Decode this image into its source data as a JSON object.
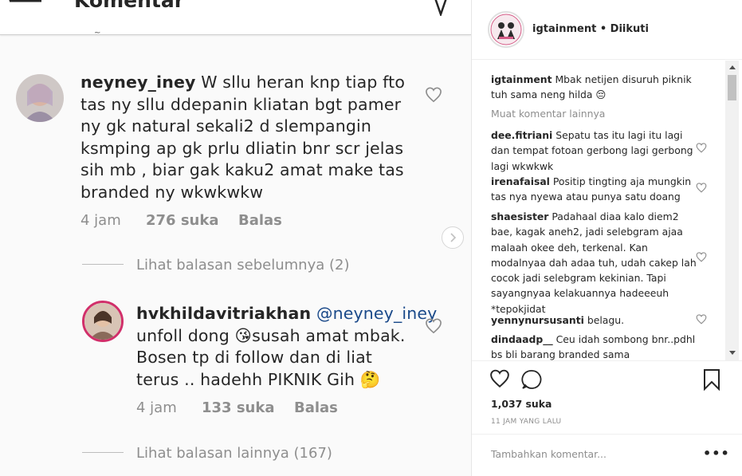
{
  "left": {
    "title": "Komentar",
    "tick_char": "~",
    "comment1": {
      "username": "neyney_iney",
      "lines": [
        "W sllu heran knp tiap fto",
        "tas ny sllu ddepanin kliatan bgt pamer",
        "ny gk natural sekali2 d slempangin",
        "ksmping ap gk prlu dliatin bnr scr jelas",
        "sih mb , biar gak kaku2 amat make tas",
        "branded ny wkwkwkw"
      ],
      "time": "4 jam",
      "likes": "276 suka",
      "reply": "Balas"
    },
    "view_previous": "Lihat balasan sebelumnya (2)",
    "comment2": {
      "username": "hvkhildavitriakhan",
      "mention": "@neyney_iney",
      "line1_a": "unfoll dong",
      "line1_emoji": "😘",
      "line1_b": "susah amat mbak.",
      "line2": "Bosen tp di follow dan di liat",
      "line3": "terus .. hadehh PIKNIK Gih 🤔",
      "time": "4 jam",
      "likes": "133 suka",
      "reply": "Balas"
    },
    "view_more": "Lihat balasan lainnya (167)"
  },
  "right": {
    "poster": "igtainment",
    "follow_status": "• Diikuti",
    "caption_user": "igtainment",
    "caption_text": "Mbak netijen disuruh piknik tuh sama neng hilda 😔",
    "more_comments": "Muat komentar lainnya",
    "comments": [
      {
        "user": "dee.fitriani",
        "text": "Sepatu tas itu lagi itu lagi dan tempat fotoan gerbong lagi gerbong lagi wkwkwk"
      },
      {
        "user": "irenafaisal",
        "text": "Positip tingting aja mungkin tas nya nyewa atau punya satu doang"
      },
      {
        "user": "shaesister",
        "text": "Padahaal diaa kalo diem2 bae, kagak aneh2, jadi selebgram ajaa malaah okee deh, terkenal. Kan modalnyaa dah adaa tuh, udah cakep lah cocok jadi selebgram kekinian. Tapi sayangnyaa kelakuannya hadeeeuh *tepokjidat"
      },
      {
        "user": "yennynursusanti",
        "text": "belagu."
      },
      {
        "user": "dindaadp__",
        "text": "Ceu idah sombong bnr..pdhl bs bli barang branded sama"
      }
    ],
    "likes": "1,037 suka",
    "time_ago": "11 JAM YANG LALU",
    "add_comment_placeholder": "Tambahkan komentar...",
    "more_options": "•••"
  }
}
